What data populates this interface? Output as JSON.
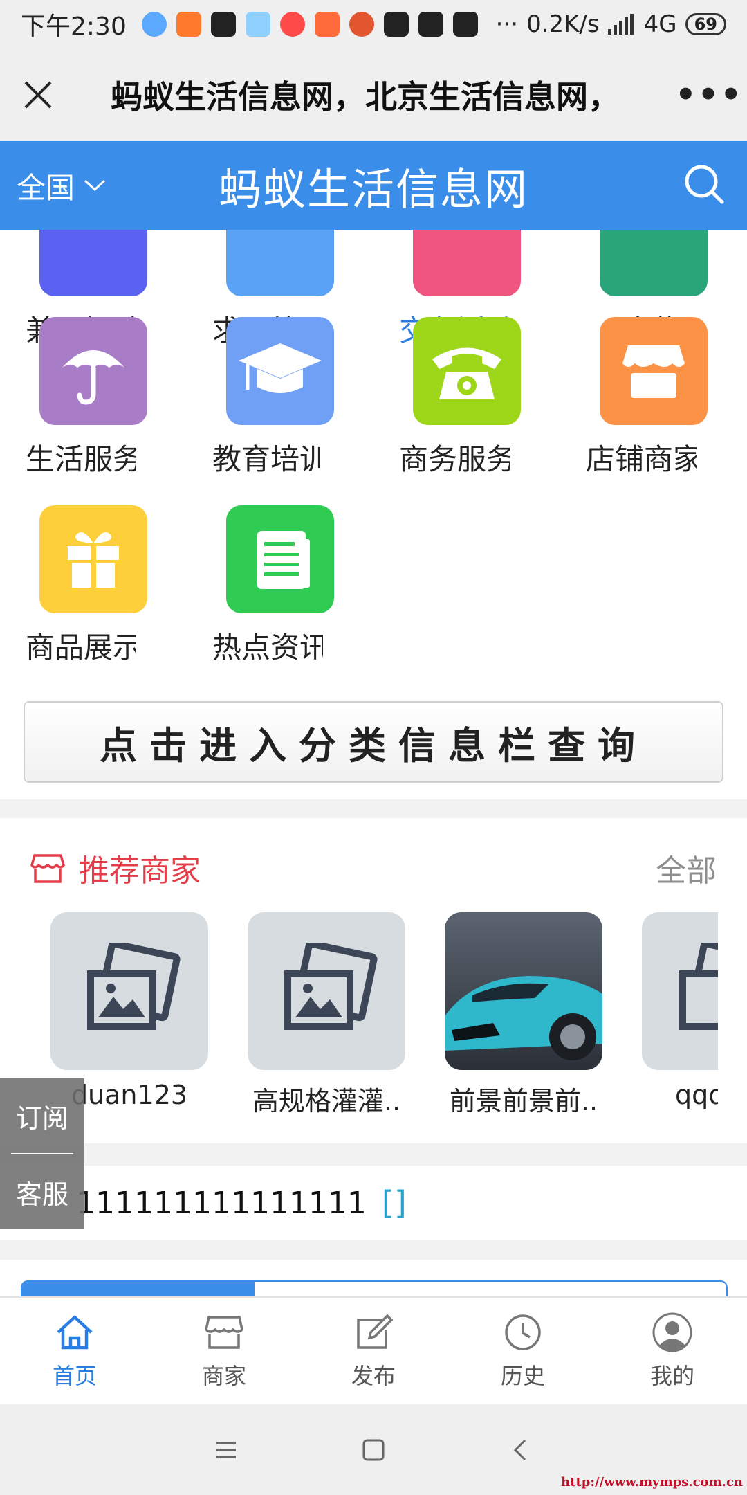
{
  "status_bar": {
    "time": "下午2:30",
    "network_speed": "0.2K/s",
    "network_type": "4G",
    "battery": "69",
    "app_colors": [
      "#5aa9ff",
      "#ff7a2b",
      "#222222",
      "#8fd0ff",
      "#ff4a4a",
      "#ff6b3a",
      "#e2562f",
      "#222222",
      "#222222",
      "#222222"
    ]
  },
  "webview": {
    "title": "蚂蚁生活信息网，北京生活信息网，",
    "more": "•••"
  },
  "header": {
    "city": "全国",
    "site_name": "蚂蚁生活信息网",
    "bg_color": "#3a8de8"
  },
  "categories": {
    "top_row": [
      {
        "label": "兼职招聘",
        "color": "#5b61f0"
      },
      {
        "label": "求职简历",
        "color": "#5aa2f5"
      },
      {
        "label": "交友活动",
        "color": "#f0557f"
      },
      {
        "label": "宠物",
        "color": "#2aa57a"
      }
    ],
    "row2": [
      {
        "label": "生活服务",
        "icon": "umbrella-icon",
        "color": "#a97cc8"
      },
      {
        "label": "教育培训",
        "icon": "graduation-cap-icon",
        "color": "#6fa0f5"
      },
      {
        "label": "商务服务",
        "icon": "telephone-icon",
        "color": "#9ed619"
      },
      {
        "label": "店铺商家",
        "icon": "shop-icon",
        "color": "#fb9246"
      }
    ],
    "row3": [
      {
        "label": "商品展示",
        "icon": "gift-icon",
        "color": "#fdd03b"
      },
      {
        "label": "热点资讯",
        "icon": "newspaper-icon",
        "color": "#2fcb52"
      }
    ]
  },
  "query_button": "点击进入分类信息栏查询",
  "merchants": {
    "title": "推荐商家",
    "all_label": "全部",
    "items": [
      {
        "name": "duan123"
      },
      {
        "name": "高规格灌灌.."
      },
      {
        "name": "前景前景前.."
      },
      {
        "name": "qqq"
      }
    ]
  },
  "notice": {
    "text": "111111111111111",
    "bracket": "[]"
  },
  "side_float": {
    "subscribe": "订阅",
    "service": "客服"
  },
  "bottom_nav": [
    {
      "label": "首页",
      "icon": "home-icon"
    },
    {
      "label": "商家",
      "icon": "store-icon"
    },
    {
      "label": "发布",
      "icon": "edit-icon"
    },
    {
      "label": "历史",
      "icon": "clock-icon"
    },
    {
      "label": "我的",
      "icon": "user-icon"
    }
  ],
  "watermark": "http://www.mymps.com.cn"
}
